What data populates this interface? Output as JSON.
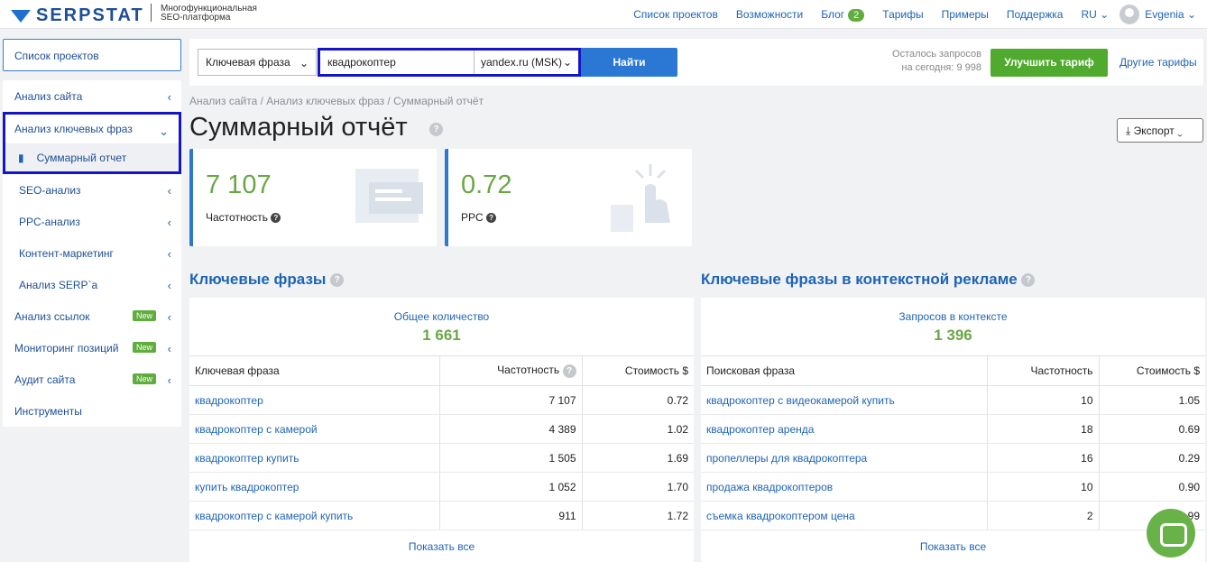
{
  "header": {
    "logo_text": "SERPSTAT",
    "logo_subtitle": "Многофункциональная SEO-платформа",
    "nav": [
      {
        "label": "Список проектов"
      },
      {
        "label": "Возможности"
      },
      {
        "label": "Блог",
        "badge": "2"
      },
      {
        "label": "Тарифы"
      },
      {
        "label": "Примеры"
      },
      {
        "label": "Поддержка"
      }
    ],
    "language": "RU",
    "user_name": "Evgenia"
  },
  "sidebar": {
    "projects_button": "Список проектов",
    "items": [
      {
        "label": "Анализ сайта"
      },
      {
        "label": "Анализ ключевых фраз"
      },
      {
        "label": "Суммарный отчет"
      },
      {
        "label": "SEO-анализ"
      },
      {
        "label": "PPC-анализ"
      },
      {
        "label": "Контент-маркетинг"
      },
      {
        "label": "Анализ SERP`а"
      },
      {
        "label": "Анализ ссылок",
        "badge": "New"
      },
      {
        "label": "Мониторинг позиций",
        "badge": "New"
      },
      {
        "label": "Аудит сайта",
        "badge": "New"
      },
      {
        "label": "Инструменты"
      }
    ]
  },
  "search": {
    "type_select": "Ключевая фраза",
    "query_value": "квадрокоптер",
    "database_select": "yandex.ru (MSK)",
    "submit_label": "Найти",
    "remaining_label": "Осталось запросов",
    "remaining_value": "на сегодня: 9 998",
    "upgrade_label": "Улучшить тариф",
    "other_plans_label": "Другие тарифы"
  },
  "breadcrumb": "Анализ сайта / Анализ ключевых фраз / Суммарный отчёт",
  "page_title": "Суммарный отчёт",
  "export_label": "Экспорт",
  "stats": [
    {
      "value": "7 107",
      "label": "Частотность"
    },
    {
      "value": "0.72",
      "label": "PPC"
    }
  ],
  "keywords_section": {
    "title": "Ключевые фразы",
    "total_label": "Общее количество",
    "total_value": "1 661",
    "columns": [
      "Ключевая фраза",
      "Частотность",
      "Стоимость $"
    ],
    "rows": [
      [
        "квадрокоптер",
        "7 107",
        "0.72"
      ],
      [
        "квадрокоптер с камерой",
        "4 389",
        "1.02"
      ],
      [
        "квадрокоптер купить",
        "1 505",
        "1.69"
      ],
      [
        "купить квадрокоптер",
        "1 052",
        "1.70"
      ],
      [
        "квадрокоптер с камерой купить",
        "911",
        "1.72"
      ]
    ],
    "show_all": "Показать все"
  },
  "ads_section": {
    "title": "Ключевые фразы в контекстной рекламе",
    "total_label": "Запросов в контексте",
    "total_value": "1 396",
    "columns": [
      "Поисковая фраза",
      "Частотность",
      "Стоимость $"
    ],
    "rows": [
      [
        "квадрокоптер с видеокамерой купить",
        "10",
        "1.05"
      ],
      [
        "квадрокоптер аренда",
        "18",
        "0.69"
      ],
      [
        "пропеллеры для квадрокоптера",
        "16",
        "0.29"
      ],
      [
        "продажа квадрокоптеров",
        "10",
        "0.90"
      ],
      [
        "съемка квадрокоптером цена",
        "2",
        "0.99"
      ]
    ],
    "show_all": "Показать все"
  },
  "colors": {
    "brand_blue": "#1e64b5",
    "accent_green": "#6aa744",
    "highlight_frame": "#1515c8"
  }
}
